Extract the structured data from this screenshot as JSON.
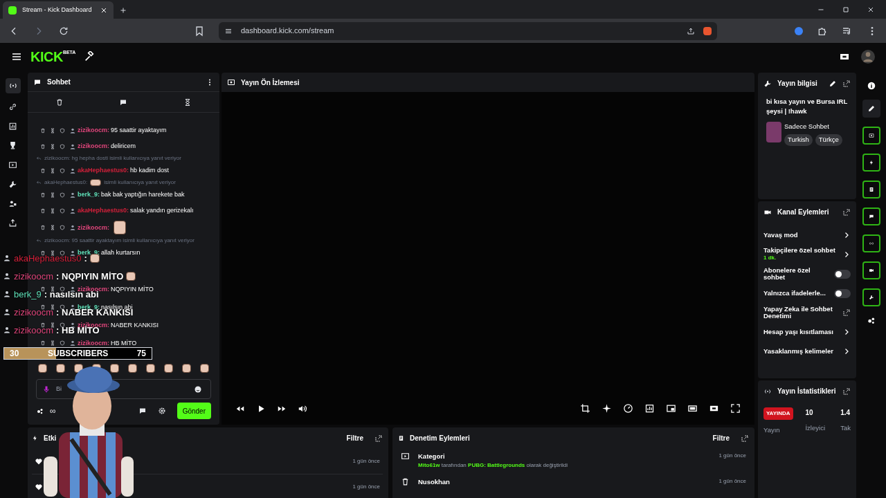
{
  "browser": {
    "tab_title": "Stream - Kick Dashboard",
    "url": "dashboard.kick.com/stream"
  },
  "header": {
    "logo": "KICK",
    "logo_badge": "BETA"
  },
  "chat": {
    "title": "Sohbet",
    "messages": [
      {
        "kind": "message",
        "user": "zizikoocm:",
        "color": "#e0457b",
        "text": "95 saattir ayaktayım"
      },
      {
        "kind": "message",
        "user": "zizikoocm:",
        "color": "#e0457b",
        "text": "deliricem"
      },
      {
        "kind": "reply",
        "text": "zizikoocm: hg hepha dosti isimli kullanıcıya yanıt veriyor"
      },
      {
        "kind": "message",
        "user": "akaHephaestus0:",
        "color": "#d4203a",
        "text": "hb kadim dost"
      },
      {
        "kind": "reply",
        "text": "akaHephaestus0:",
        "emote": true,
        "text_after": "isimli kullanıcıya yanıt veriyor"
      },
      {
        "kind": "message",
        "user": "berk_9:",
        "color": "#5fe0b8",
        "text": "bak bak yaptığın harekete bak"
      },
      {
        "kind": "message",
        "user": "akaHephaestus0:",
        "color": "#d4203a",
        "text": "salak yandın gerizekalı"
      },
      {
        "kind": "message",
        "user": "zizikoocm:",
        "color": "#e0457b",
        "emote": true
      },
      {
        "kind": "reply",
        "text": "zizikoocm: 95 saattir ayaktayım isimli kullanıcıya yanıt veriyor"
      },
      {
        "kind": "message",
        "user": "berk_9:",
        "color": "#5fe0b8",
        "text": "allah kurtarsın"
      },
      {
        "kind": "message",
        "user": "zizikoocm:",
        "color": "#e0457b",
        "text": "NQPIYIN MİTO"
      },
      {
        "kind": "message",
        "user": "berk_9:",
        "color": "#5fe0b8",
        "text": "nasılsın abi"
      },
      {
        "kind": "message",
        "user": "zizikoocm:",
        "color": "#e0457b",
        "text": "NABER KANKISI"
      },
      {
        "kind": "message",
        "user": "zizikoocm:",
        "color": "#e0457b",
        "text": "HB MİTO"
      }
    ],
    "overlay": [
      {
        "user": "akaHephaestus0",
        "color": "#d4203a",
        "text": ":",
        "emote": true
      },
      {
        "user": "zizikoocm",
        "color": "#e0457b",
        "text": ": NQPIYIN MİTO",
        "emote": true
      },
      {
        "user": "berk_9",
        "color": "#5fe0b8",
        "text": ": nasılsın abi"
      },
      {
        "user": "zizikoocm",
        "color": "#e0457b",
        "text": ": NABER KANKISI"
      },
      {
        "user": "zizikoocm",
        "color": "#e0457b",
        "text": ": HB MİTO"
      }
    ],
    "subscribers": {
      "start": "30",
      "label": "SUBSCRIBERS",
      "end": "75",
      "level": 0.35
    },
    "input": {
      "placeholder": "Bi"
    },
    "infinity": "∞",
    "send_label": "Gönder"
  },
  "preview": {
    "title": "Yayın Ön İzlemesi"
  },
  "stream_info": {
    "title": "Yayın bilgisi",
    "stream_title": "bi kısa yayın ve Bursa IRL şeysi | !hawk",
    "category": "Sadece Sohbet",
    "tags": [
      "Turkish",
      "Türkçe"
    ]
  },
  "channel_actions": {
    "title": "Kanal Eylemleri",
    "items": [
      {
        "kind": "link",
        "label": "Yavaş mod"
      },
      {
        "kind": "link",
        "label": "Takipçilere özel sohbet",
        "detail": "1 dk."
      },
      {
        "kind": "toggle",
        "label": "Abonelere özel sohbet",
        "on": false
      },
      {
        "kind": "toggle",
        "label": "Yalnızca ifadelerle...",
        "on": false
      },
      {
        "kind": "external",
        "label": "Yapay Zeka ile Sohbet Denetimi"
      },
      {
        "kind": "link",
        "label": "Hesap yaşı kısıtlaması"
      },
      {
        "kind": "link",
        "label": "Yasaklanmış kelimeler"
      }
    ]
  },
  "stream_stats": {
    "title": "Yayın İstatistikleri",
    "items": [
      {
        "kind": "badge",
        "value": "YAYINDA",
        "label": "Yayın"
      },
      {
        "kind": "number",
        "value": "10",
        "label": "İzleyici"
      },
      {
        "kind": "number",
        "value": "1.4",
        "label": "Tak"
      }
    ]
  },
  "activity": {
    "title": "Etki",
    "filter": "Filtre",
    "rows": [
      {
        "time": "1 gün önce"
      },
      {
        "time": "1 gün önce"
      }
    ]
  },
  "moderation": {
    "title": "Denetim Eylemleri",
    "filter": "Filtre",
    "rows": [
      {
        "kind": "category",
        "title": "Kategori",
        "detail": "**Mito61w** tarafından **PUBG: Battlegrounds** olarak değiştirildi",
        "time": "1 gün önce"
      },
      {
        "kind": "delete",
        "title": "Nusokhan",
        "time": "1 gün önce"
      }
    ]
  }
}
